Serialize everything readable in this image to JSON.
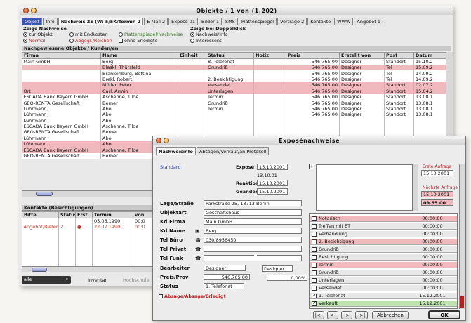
{
  "main_window": {
    "title": "Objekte / 1 von (1.202)",
    "tabs": [
      "Objekt",
      "Info",
      "Nachweis 25 (W: 5/5K/Termin 2",
      "E-Mail 2",
      "Exposé 01",
      "Bilder 1",
      "SMS",
      "Plattenspiegel",
      "Verträge 2",
      "Kontakte",
      "WWW",
      "Angebot 1"
    ],
    "zeige_nachweise": {
      "label": "Zeige Nachweise",
      "options": [
        {
          "text": "zur Objekt",
          "on": true
        },
        {
          "text": "mit Endkosten",
          "on": false
        },
        {
          "text": "Plattenspiegel/Nachweise",
          "on": false
        },
        {
          "text": "Normal",
          "on": true
        },
        {
          "text": "Abgegl./Reichen",
          "on": false
        },
        {
          "text": "ohne Erledigte",
          "on": false
        }
      ]
    },
    "zeige_doppel": {
      "label": "Zeige bei Doppelklick",
      "options": [
        {
          "text": "Nachweis/Info",
          "on": true
        },
        {
          "text": "Interessent",
          "on": false
        }
      ]
    },
    "nachweise_section": "Nachgewiesene Objekte / Kunden/en",
    "nachweise_columns": [
      "Firma",
      "Name",
      "Einheit",
      "Status",
      "Notiz",
      "Preis",
      "Erstellt von",
      "Post",
      "Datum"
    ],
    "nachweise_rows": [
      {
        "pink": false,
        "cells": [
          "Main GmbH",
          "Berg",
          "",
          "8. Telefonat",
          "",
          "546 765,00",
          "Designer",
          "Standort",
          "15.10.2"
        ]
      },
      {
        "pink": true,
        "cells": [
          "",
          "Blaskl, Thürsfeld",
          "",
          "Grundriß",
          "",
          "546 765,00",
          "Designer",
          "Tel",
          "15.09.2"
        ]
      },
      {
        "pink": false,
        "cells": [
          "",
          "Brankenburg, Bettina",
          "",
          "",
          "",
          "546 765,00",
          "Designer",
          "Tel",
          "14.09.2"
        ]
      },
      {
        "pink": false,
        "cells": [
          "",
          "Brekl, Robert",
          "",
          "2. Besichtigung",
          "",
          "546 765,00",
          "Designer",
          "Tel",
          "14.09.2"
        ]
      },
      {
        "pink": true,
        "cells": [
          "",
          "Müller, Peter",
          "",
          "Versendet",
          "",
          "546 765,00",
          "Designer",
          "Standort",
          "02.07.2"
        ]
      },
      {
        "pink": true,
        "cells": [
          "Ort",
          "Carl, Armin",
          "",
          "Unterlagen",
          "",
          "546 765,00",
          "Designer",
          "Standort",
          "15.04.2"
        ]
      },
      {
        "pink": false,
        "cells": [
          "ESCADA Bank Bayern GmbH",
          "Aschenne, Tilde",
          "",
          "Termin",
          "",
          "546 765,00",
          "Designer",
          "Standort",
          "13.08.1"
        ]
      },
      {
        "pink": false,
        "cells": [
          "GEO-RENTA Gesellschaft",
          "Berner",
          "",
          "Grundriß",
          "",
          "546 765,00",
          "Designer",
          "Standort",
          "13.08.1"
        ]
      },
      {
        "pink": false,
        "cells": [
          "Lührmann",
          "Abo",
          "",
          "Termin",
          "",
          "546 765,00",
          "Designer",
          "Standort",
          "13.08.1"
        ]
      },
      {
        "pink": false,
        "cells": [
          "Lührmann",
          "Abo",
          "",
          "",
          "",
          "546 765,00",
          "Designer",
          "Standort",
          "13.08.1"
        ]
      },
      {
        "pink": false,
        "cells": [
          "Lührmann",
          "Abo",
          "",
          "",
          "",
          "",
          "",
          "",
          ""
        ]
      },
      {
        "pink": false,
        "cells": [
          "ESCADA Bank Bayern GmbH",
          "Aschenne, Tilde",
          "",
          "",
          "",
          "",
          "",
          "",
          ""
        ]
      },
      {
        "pink": false,
        "cells": [
          "GEO-RENTA Gesellschaft",
          "Berner",
          "",
          "",
          "",
          "",
          "",
          "",
          ""
        ]
      },
      {
        "pink": false,
        "cells": [
          "Lührmann",
          "Abo",
          "",
          "",
          "",
          "",
          "",
          "",
          ""
        ]
      },
      {
        "pink": true,
        "cells": [
          "Lührmann",
          "Abo",
          "",
          "",
          "",
          "",
          "",
          "",
          ""
        ]
      },
      {
        "pink": true,
        "cells": [
          "ESCADA Bank Bayern GmbH",
          "Aschenne, Tilde",
          "",
          "",
          "",
          "",
          "",
          "",
          ""
        ]
      },
      {
        "pink": false,
        "cells": [
          "GEO-RENTA Gesellschaft",
          "Berner",
          "",
          "",
          "",
          "",
          "",
          "",
          ""
        ]
      }
    ],
    "kontakte_section": "Kontakte (Besichtigungen)",
    "kontakte_columns": [
      "Bitte",
      "Status",
      "Erst.",
      "Termin",
      "von"
    ],
    "kontakte_rows": [
      {
        "cells": [
          "",
          "",
          "",
          "05.06.1990",
          "00:0"
        ],
        "red": false
      },
      {
        "cells": [
          "Angebot/Bieter",
          "✓",
          "●",
          "22.07.1990",
          "00:0"
        ],
        "red": true
      }
    ],
    "bottom_select": "alle",
    "bottom_label1": "Inventar",
    "bottom_label2": "Hochschule"
  },
  "expose_window": {
    "title": "Exposénachweise",
    "tabs": [
      "Nachweisinfo",
      "Absagen/Verkauf/an Protokoll"
    ],
    "standard_label": "Standard",
    "dates": [
      {
        "label": "Exposé",
        "value": "15.10.2001"
      },
      {
        "label": "",
        "value": "13.10.01"
      },
      {
        "label": "Reaktion",
        "value": "15.10.2001"
      },
      {
        "label": "Geändert",
        "value": "15.10.2001"
      }
    ],
    "right_dates": [
      {
        "label": "Erste Anfrage",
        "value": "15.10.2001"
      },
      {
        "label": "Nächste Anfrage",
        "value": "15.10.2001"
      },
      {
        "label": "",
        "value": "09.55.00"
      }
    ],
    "fields": [
      {
        "label": "Lage/Straße",
        "value": "Parkstraße 25, 13713 Berlin"
      },
      {
        "label": "Objektart",
        "value": "Geschäftshaus"
      },
      {
        "label": "Kd.Firma",
        "value": "Main GmbH"
      },
      {
        "label": "Kd.Name",
        "value": "Berg"
      },
      {
        "label": "Tel Büro",
        "value": "030/8956450"
      },
      {
        "label": "Tel Privat",
        "value": ""
      },
      {
        "label": "Tel Funk",
        "value": ""
      },
      {
        "label": "Bearbeiter",
        "value": "Designer"
      },
      {
        "label": "Preis/Prov",
        "value": "546.765,00"
      },
      {
        "label": "Status",
        "value": "1. Telefonat"
      }
    ],
    "bearbeiter2": "Designer",
    "prov_value": "0,00%",
    "absage_label": "Absage/Absage/Erledigt",
    "status_list": [
      {
        "label": "Notorisch",
        "time": "00:00:00",
        "on": false,
        "color": "#efb9bd"
      },
      {
        "label": "Treffen mit ET",
        "time": "00:00:00",
        "on": false,
        "color": "#e8e8e8"
      },
      {
        "label": "Verhandlung",
        "time": "00:00:00",
        "on": false,
        "color": "#e8e8e8"
      },
      {
        "label": "2. Besichtigung",
        "time": "00:00:00",
        "on": false,
        "color": "#efb9bd"
      },
      {
        "label": "Grundriß",
        "time": "00:00:00",
        "on": false,
        "color": "#e8e8e8"
      },
      {
        "label": "Besichtigung",
        "time": "00:00:00",
        "on": false,
        "color": "#e8e8e8"
      },
      {
        "label": "Termin",
        "time": "00:00:00",
        "on": false,
        "color": "#efb9bd"
      },
      {
        "label": "Grundriß",
        "time": "00:00:00",
        "on": false,
        "color": "#e8e8e8"
      },
      {
        "label": "Unterlagen",
        "time": "00:00:00",
        "on": false,
        "color": "#e8e8e8"
      },
      {
        "label": "Versendet",
        "time": "00:00:00",
        "on": false,
        "color": "#e8e8e8"
      },
      {
        "label": "1. Telefonat",
        "time": "15.12.2001",
        "on": true,
        "color": "#e8e8e8"
      },
      {
        "label": "Verkauft",
        "time": "15.12.2001",
        "on": true,
        "color": "#bfe3b0"
      }
    ],
    "nav_buttons": [
      "|<-",
      "<-",
      "->",
      "->|"
    ],
    "cancel_label": "Abbrechen",
    "ok_label": "OK"
  }
}
